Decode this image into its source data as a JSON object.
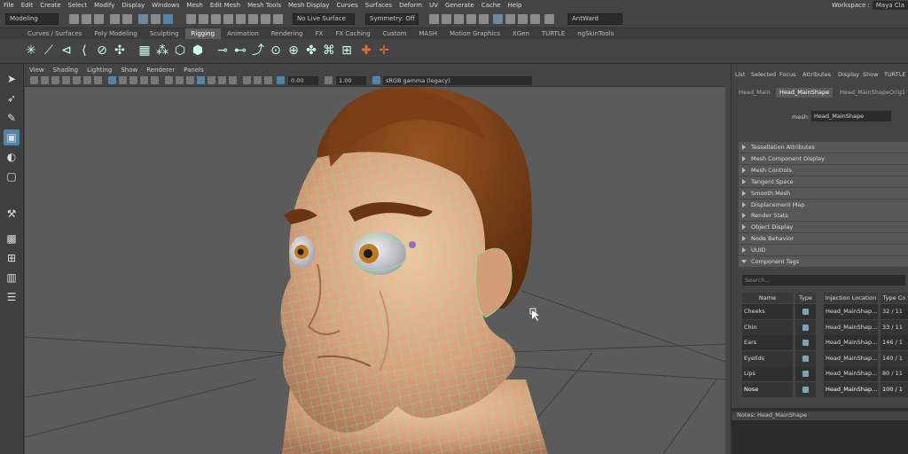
{
  "menu": [
    "File",
    "Edit",
    "Create",
    "Select",
    "Modify",
    "Display",
    "Windows",
    "Mesh",
    "Edit Mesh",
    "Mesh Tools",
    "Mesh Display",
    "Curves",
    "Surfaces",
    "Deform",
    "UV",
    "Generate",
    "Cache",
    "Help"
  ],
  "workspace": {
    "label": "Workspace :",
    "value": "Maya Cla"
  },
  "status": {
    "mode": "Modeling",
    "live_surface": "No Live Surface",
    "symmetry": "Symmetry: Off",
    "user": "AntWard"
  },
  "shelf_tabs": [
    "Curves / Surfaces",
    "Poly Modeling",
    "Sculpting",
    "Rigging",
    "Animation",
    "Rendering",
    "FX",
    "FX Caching",
    "Custom",
    "MASH",
    "Motion Graphics",
    "XGen",
    "TURTLE",
    "ngSkinTools"
  ],
  "shelf_active": "Rigging",
  "panel_menu": [
    "View",
    "Shading",
    "Lighting",
    "Show",
    "Renderer",
    "Panels"
  ],
  "panel_fields": {
    "exposure": "0.00",
    "gamma": "1.00",
    "colorspace": "sRGB gamma (legacy)"
  },
  "right_tabs": [
    "List",
    "Selected",
    "Focus",
    "Attributes",
    "Display",
    "Show",
    "TURTLE"
  ],
  "editor_tabs": [
    "Head_Main",
    "Head_MainShape",
    "Head_MainShapeOrig1"
  ],
  "editor_active": "Head_MainShape",
  "mesh_field": {
    "label": "mesh:",
    "value": "Head_MainShape"
  },
  "sections": [
    "Tessellation Attributes",
    "Mesh Component Display",
    "Mesh Controls",
    "Tangent Space",
    "Smooth Mesh",
    "Displacement Map",
    "Render Stats",
    "Object Display",
    "Node Behavior",
    "UUID",
    "Component Tags"
  ],
  "search_placeholder": "Search...",
  "table": {
    "headers": [
      "Name",
      "Type",
      "Injection Location",
      "Type Co"
    ],
    "rows": [
      {
        "name": "Cheeks",
        "location": "Head_MainShap...",
        "count": "32 / 11"
      },
      {
        "name": "Chin",
        "location": "Head_MainShap...",
        "count": "33 / 11"
      },
      {
        "name": "Ears",
        "location": "Head_MainShap...",
        "count": "146 / 1"
      },
      {
        "name": "Eyelids",
        "location": "Head_MainShap...",
        "count": "140 / 1"
      },
      {
        "name": "Lips",
        "location": "Head_MainShap...",
        "count": "80 / 11"
      },
      {
        "name": "Nose",
        "location": "Head_MainShap...",
        "count": "100 / 1"
      }
    ],
    "selected_row": 5
  },
  "notes": "Notes:  Head_MainShape",
  "colors": {
    "accent": "#5285a6",
    "wire": "#6dff9a",
    "skin": "#d9a883",
    "hair": "#6a3512"
  }
}
